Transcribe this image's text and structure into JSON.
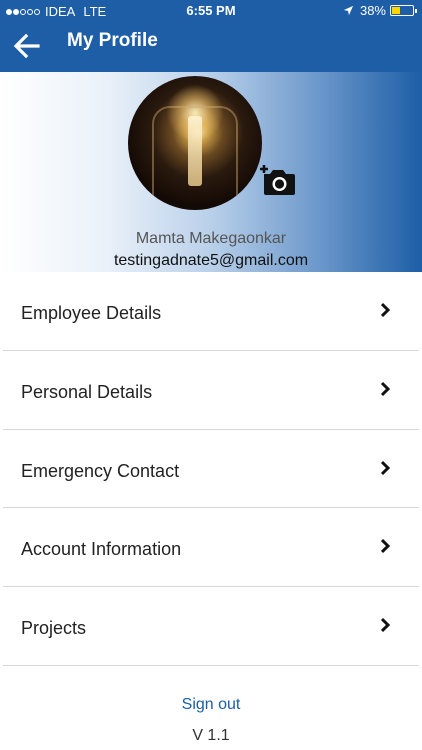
{
  "status_bar": {
    "carrier": "IDEA",
    "network": "LTE",
    "time": "6:55 PM",
    "battery_percent": "38%",
    "battery_level": 0.38,
    "signal_bars_filled": 2,
    "signal_bars_total": 5
  },
  "nav": {
    "title": "My Profile",
    "back_icon": "arrow-left-icon"
  },
  "profile": {
    "name": "Mamta Makegaonkar",
    "email": "testingadnate5@gmail.com",
    "camera_icon": "add-photo-camera-icon"
  },
  "menu": {
    "items": [
      {
        "label": "Employee Details"
      },
      {
        "label": "Personal Details"
      },
      {
        "label": "Emergency Contact"
      },
      {
        "label": "Account Information"
      },
      {
        "label": "Projects"
      }
    ]
  },
  "footer": {
    "sign_out": "Sign out",
    "version": "V 1.1"
  },
  "colors": {
    "primary": "#1d5ea6",
    "battery": "#ffd600",
    "divider": "#d8d8d8"
  }
}
